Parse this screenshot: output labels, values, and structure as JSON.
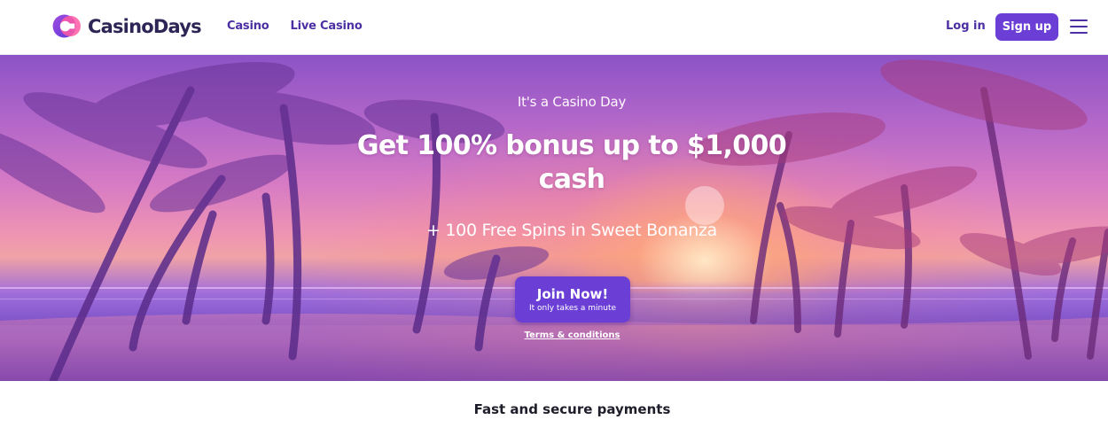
{
  "header": {
    "brand": "CasinoDays",
    "nav": [
      {
        "label": "Casino"
      },
      {
        "label": "Live Casino"
      }
    ],
    "login_label": "Log in",
    "signup_label": "Sign up"
  },
  "hero": {
    "kicker": "It's a Casino Day",
    "headline": "Get 100% bonus up to $1,000 cash",
    "subheadline": "+ 100 Free Spins in Sweet Bonanza",
    "cta_label": "Join Now!",
    "cta_sublabel": "It only takes a minute",
    "terms_label": "Terms & conditions"
  },
  "section": {
    "title": "Fast and secure payments"
  },
  "colors": {
    "brand_purple": "#6b3fd6",
    "nav_text": "#4b2fa3",
    "logo_text": "#2c2555"
  },
  "icons": {
    "logo": "casino-days-logo-icon",
    "menu": "hamburger-menu-icon"
  }
}
